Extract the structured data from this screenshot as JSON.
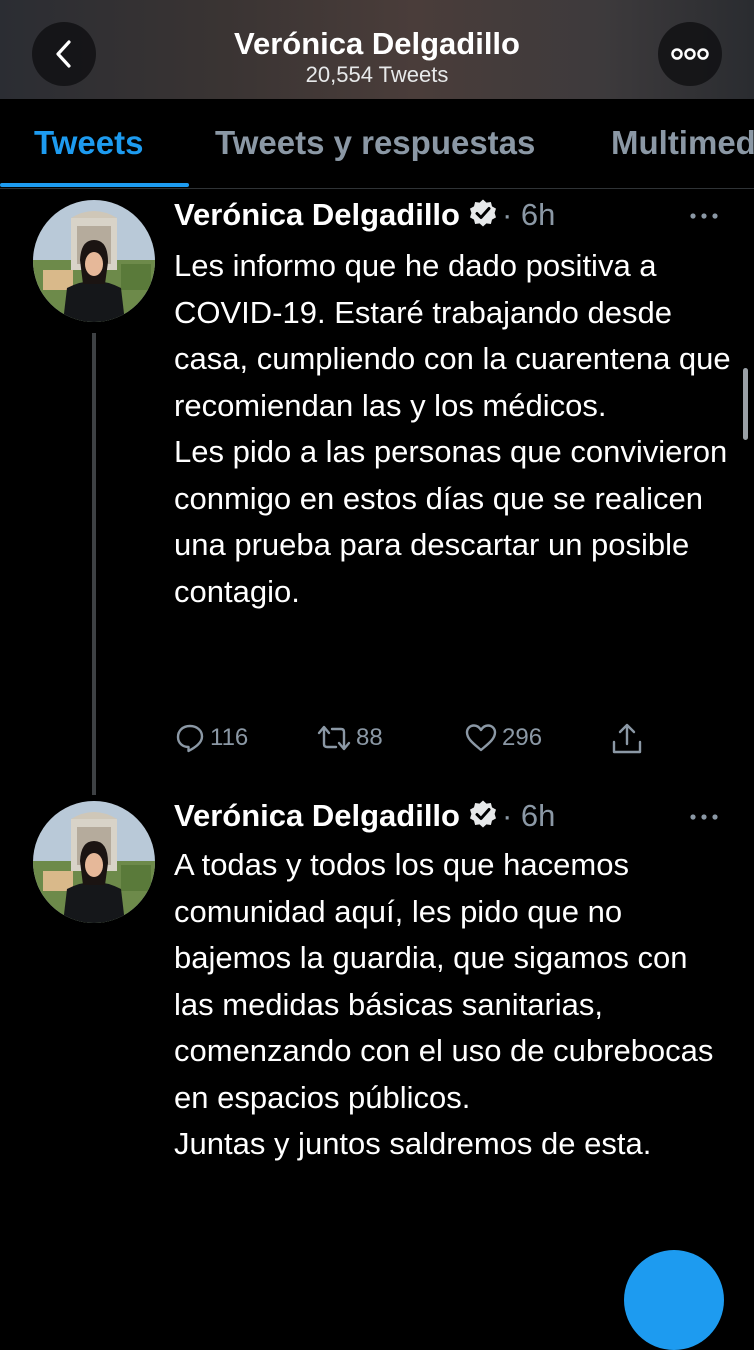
{
  "header": {
    "title": "Verónica Delgadillo",
    "subtitle": "20,554 Tweets"
  },
  "tabs": [
    {
      "label": "Tweets",
      "active": true
    },
    {
      "label": "Tweets y respuestas",
      "active": false
    },
    {
      "label": "Multimedia",
      "active": false
    }
  ],
  "tweets": [
    {
      "name": "Verónica Delgadillo",
      "time": "· 6h",
      "text": "Les informo que he dado positiva a COVID-19. Estaré trabajando desde casa, cumpliendo con la cuarentena que recomiendan las y los médicos.\nLes pido a las personas que convivieron conmigo en estos días que se realicen una prueba para descartar un posible contagio.",
      "replies": "116",
      "retweets": "88",
      "likes": "296"
    },
    {
      "name": "Verónica Delgadillo",
      "time": "· 6h",
      "text": "A todas y todos los que hacemos comunidad aquí, les pido que no bajemos la guardia, que sigamos con las medidas básicas sanitarias, comenzando con el uso de cubrebocas en espacios públicos.\nJuntas y juntos saldremos de esta."
    }
  ],
  "colors": {
    "accent": "#1d9bf0",
    "muted": "#8b98a5",
    "background": "#000000"
  },
  "icons": {
    "back": "chevron-left-icon",
    "more": "more-horizontal-icon",
    "verified": "verified-badge-icon",
    "reply": "reply-icon",
    "retweet": "retweet-icon",
    "like": "heart-icon",
    "share": "share-icon",
    "compose": "compose-icon"
  }
}
